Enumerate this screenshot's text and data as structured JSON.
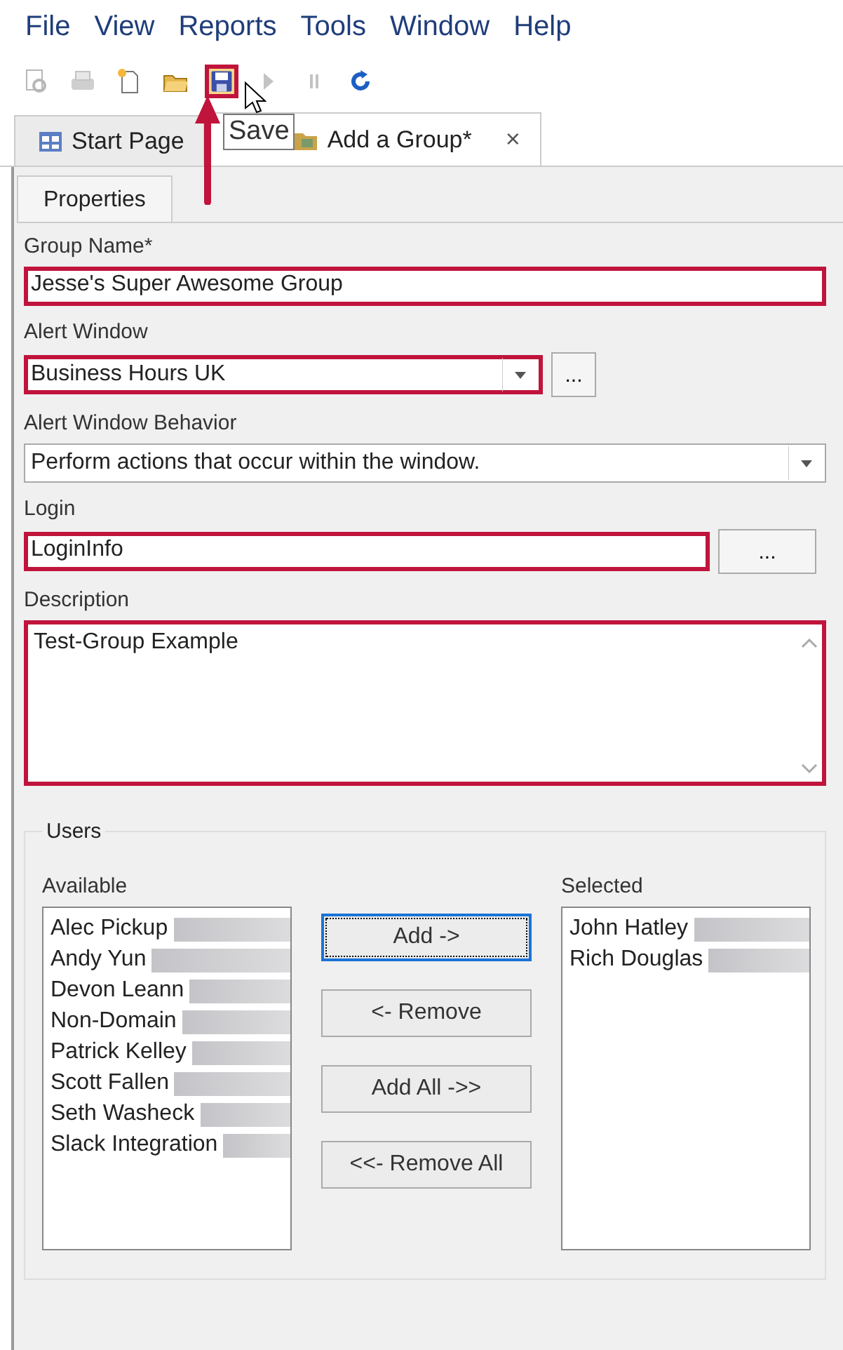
{
  "menu": [
    "File",
    "View",
    "Reports",
    "Tools",
    "Window",
    "Help"
  ],
  "toolbar": [
    {
      "kind": "preview",
      "disabled": true,
      "highlighted": false
    },
    {
      "kind": "print",
      "disabled": true,
      "highlighted": false
    },
    {
      "kind": "new",
      "disabled": false,
      "highlighted": false
    },
    {
      "kind": "open",
      "disabled": false,
      "highlighted": false
    },
    {
      "kind": "save",
      "disabled": false,
      "highlighted": true
    },
    {
      "kind": "play",
      "disabled": true,
      "highlighted": false
    },
    {
      "kind": "pause",
      "disabled": true,
      "highlighted": false
    },
    {
      "kind": "refresh",
      "disabled": false,
      "highlighted": false
    }
  ],
  "tooltip": "Save",
  "tabs": [
    {
      "label": "Start Page",
      "selected": false
    },
    {
      "label": "Add a Group*",
      "selected": true,
      "close": "×"
    }
  ],
  "subtabs": [
    {
      "label": "Properties",
      "selected": true
    }
  ],
  "fields": [
    {
      "kind": "text",
      "label": "Group Name*",
      "value": "Jesse's Super Awesome Group",
      "highlighted": true
    },
    {
      "kind": "dropdown",
      "label": "Alert Window",
      "value": "Business Hours UK",
      "highlighted": true,
      "button": "..."
    },
    {
      "kind": "dropdown",
      "label": "Alert Window Behavior",
      "value": "Perform actions that occur within the window.",
      "highlighted": false
    },
    {
      "kind": "text",
      "label": "Login",
      "value": "LoginInfo",
      "highlighted": true,
      "button": "..."
    },
    {
      "kind": "textarea",
      "label": "Description",
      "value": "Test-Group Example",
      "highlighted": true
    }
  ],
  "users": {
    "legend": "Users",
    "available_label": "Available",
    "available": [
      "Alec Pickup",
      "Andy Yun",
      "Devon Leann",
      "Non-Domain",
      "Patrick Kelley",
      "Scott Fallen",
      "Seth Washeck",
      "Slack Integration"
    ],
    "buttons": [
      {
        "label": "Add ->",
        "focused": true
      },
      {
        "label": "<- Remove",
        "focused": false
      },
      {
        "label": "Add All ->>",
        "focused": false
      },
      {
        "label": "<<- Remove All",
        "focused": false
      }
    ],
    "selected_label": "Selected",
    "selected": [
      "John Hatley",
      "Rich Douglas"
    ]
  }
}
